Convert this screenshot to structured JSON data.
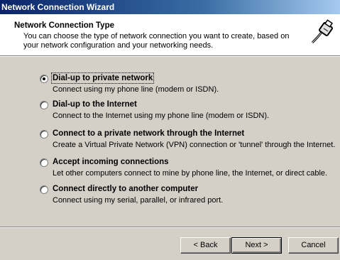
{
  "window": {
    "title": "Network Connection Wizard"
  },
  "header": {
    "title": "Network Connection Type",
    "description": "You can choose the type of network connection you want to create, based on your network configuration and your networking needs.",
    "icon": "network-plug-icon"
  },
  "options": [
    {
      "label": "Dial-up to private network",
      "description": "Connect using my phone line (modem or ISDN).",
      "selected": true
    },
    {
      "label": "Dial-up to the Internet",
      "description": "Connect to the Internet using my phone line (modem or ISDN).",
      "selected": false
    },
    {
      "label": "Connect to a private network through the Internet",
      "description": "Create a Virtual Private Network (VPN) connection or 'tunnel' through the Internet.",
      "selected": false
    },
    {
      "label": "Accept incoming connections",
      "description": "Let other computers connect to mine by phone line, the Internet, or direct cable.",
      "selected": false
    },
    {
      "label": "Connect directly to another computer",
      "description": "Connect using my serial, parallel, or infrared port.",
      "selected": false
    }
  ],
  "buttons": {
    "back": "< Back",
    "next": "Next >",
    "cancel": "Cancel"
  }
}
